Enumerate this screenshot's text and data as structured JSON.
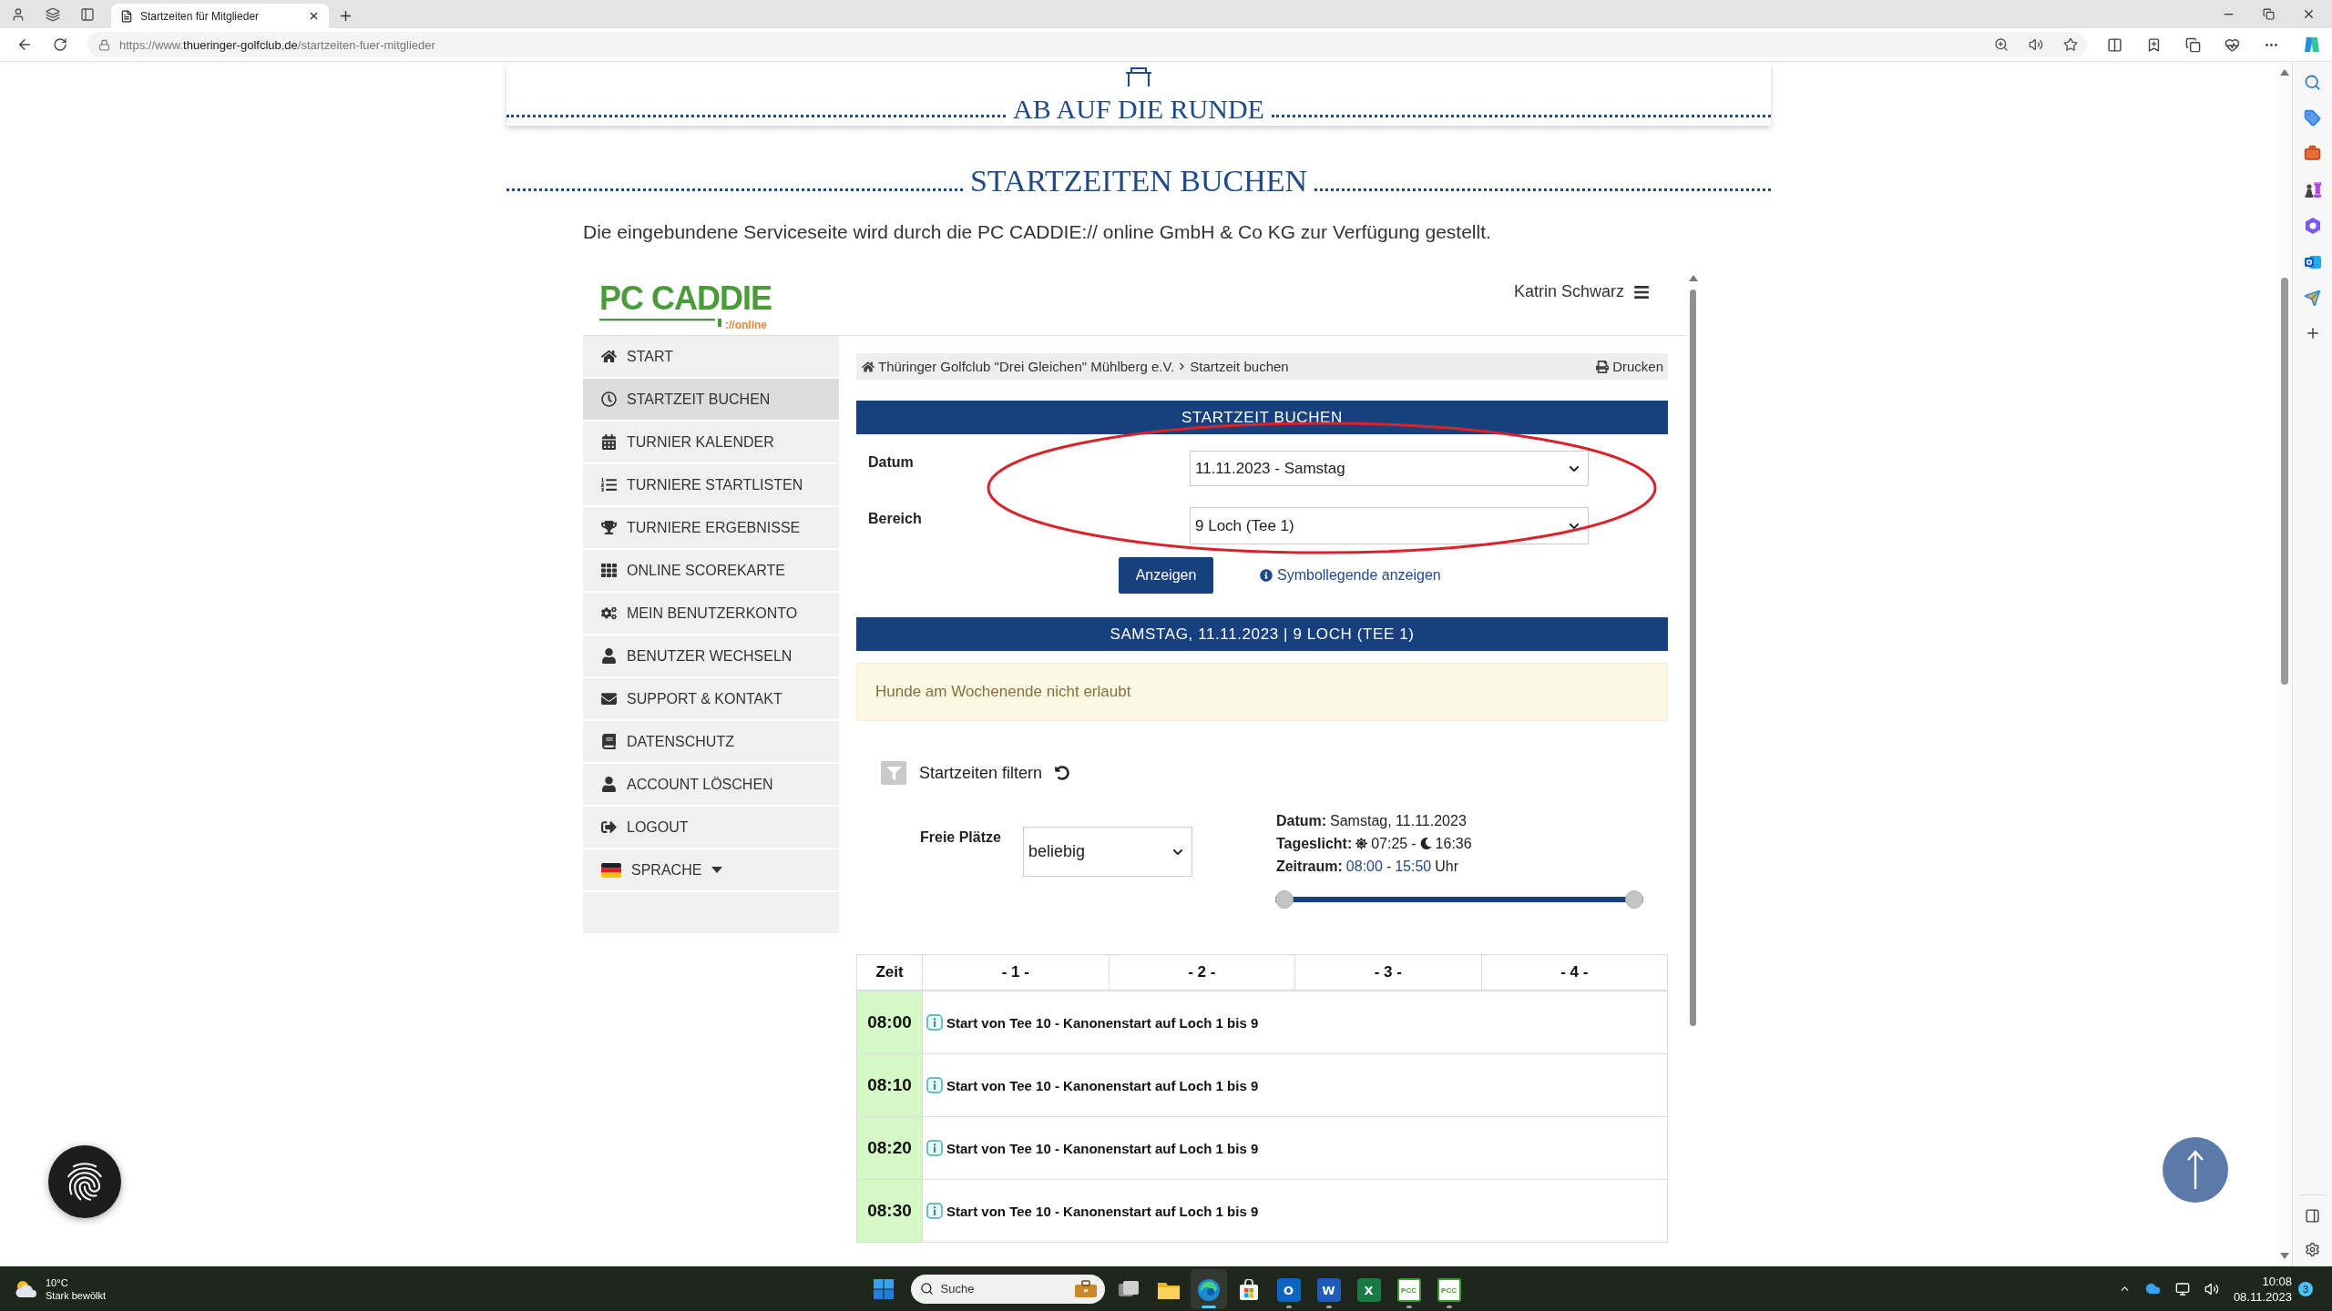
{
  "browser": {
    "tab": {
      "title": "Startzeiten für Mitglieder",
      "selected": true
    },
    "url": {
      "scheme": "https://www.",
      "domain": "thueringer-golfclub.de",
      "path": "/startzeiten-fuer-mitglieder"
    }
  },
  "page": {
    "banner_title": "AB AUF DIE RUNDE",
    "heading": "STARTZEITEN BUCHEN",
    "intro": "Die eingebundene Serviceseite wird durch die PC CADDIE:// online GmbH & Co KG zur Verfügung gestellt."
  },
  "portal": {
    "logo": {
      "name": "PC CADDIE",
      "suffix": "://online"
    },
    "user": "Katrin Schwarz",
    "menu": [
      {
        "label": "START",
        "kind": "link",
        "selected": false
      },
      {
        "label": "STARTZEIT BUCHEN",
        "kind": "link",
        "selected": true
      },
      {
        "label": "TURNIER KALENDER",
        "kind": "link",
        "selected": false
      },
      {
        "label": "TURNIERE STARTLISTEN",
        "kind": "link",
        "selected": false
      },
      {
        "label": "TURNIERE ERGEBNISSE",
        "kind": "link",
        "selected": false
      },
      {
        "label": "ONLINE SCOREKARTE",
        "kind": "link",
        "selected": false
      },
      {
        "label": "MEIN BENUTZERKONTO",
        "kind": "link",
        "selected": false
      },
      {
        "label": "BENUTZER WECHSELN",
        "kind": "link",
        "selected": false
      },
      {
        "label": "SUPPORT & KONTAKT",
        "kind": "link",
        "selected": false
      },
      {
        "label": "DATENSCHUTZ",
        "kind": "link",
        "selected": false
      },
      {
        "label": "ACCOUNT LÖSCHEN",
        "kind": "link",
        "selected": false
      },
      {
        "label": "LOGOUT",
        "kind": "link",
        "selected": false
      },
      {
        "label": "SPRACHE",
        "kind": "dropdown",
        "selected": false
      }
    ],
    "breadcrumb": {
      "items": [
        "Thüringer Golfclub \"Drei Gleichen\" Mühlberg e.V.",
        "Startzeit buchen"
      ],
      "print": "Drucken"
    },
    "booking": {
      "title": "STARTZEIT BUCHEN",
      "fields": [
        {
          "label": "Datum",
          "value": "11.11.2023 - Samstag"
        },
        {
          "label": "Bereich",
          "value": "9 Loch (Tee 1)"
        }
      ],
      "submit": "Anzeigen",
      "legend_link": "Symbollegende anzeigen"
    },
    "annotation": {
      "kind": "ellipse"
    },
    "day_title": "SAMSTAG, 11.11.2023 | 9 LOCH (TEE 1)",
    "notice": "Hunde am Wochenende nicht erlaubt",
    "filter": {
      "title": "Startzeiten filtern",
      "free_places": {
        "label": "Freie Plätze",
        "value": "beliebig"
      },
      "info": {
        "date_label": "Datum:",
        "date": "Samstag, 11.11.2023",
        "daylight_label": "Tageslicht:",
        "sunrise": "07:25",
        "daylight_sep": "-",
        "sunset": "16:36",
        "range_label": "Zeitraum:",
        "range_from": "08:00",
        "range_sep": "-",
        "range_to": "15:50",
        "range_unit": "Uhr"
      },
      "slider": {
        "level": 1
      }
    },
    "table": {
      "columns": [
        "Zeit",
        "- 1 -",
        "- 2 -",
        "- 3 -",
        "- 4 -"
      ],
      "rows": [
        {
          "time": "08:00",
          "note": "Start von Tee 10 - Kanonenstart auf Loch 1 bis 9"
        },
        {
          "time": "08:10",
          "note": "Start von Tee 10 - Kanonenstart auf Loch 1 bis 9"
        },
        {
          "time": "08:20",
          "note": "Start von Tee 10 - Kanonenstart auf Loch 1 bis 9"
        },
        {
          "time": "08:30",
          "note": "Start von Tee 10 - Kanonenstart auf Loch 1 bis 9"
        }
      ]
    }
  },
  "taskbar": {
    "weather": {
      "temp": "10°C",
      "text": "Stark bewölkt"
    },
    "search": {
      "placeholder": "Suche"
    },
    "apps": [
      {
        "kind": "taskview",
        "running": false,
        "selected": false
      },
      {
        "kind": "folder",
        "running": false,
        "selected": false
      },
      {
        "kind": "browser",
        "running": true,
        "selected": true
      },
      {
        "kind": "store",
        "running": false,
        "selected": false
      },
      {
        "kind": "mail",
        "label": "O",
        "running": true,
        "selected": false
      },
      {
        "kind": "doc",
        "label": "W",
        "running": true,
        "selected": false
      },
      {
        "kind": "sheet",
        "label": "X",
        "running": false,
        "selected": false
      },
      {
        "kind": "pcc",
        "label": "PCC",
        "running": true,
        "selected": false
      },
      {
        "kind": "pcc",
        "label": "PCC",
        "running": true,
        "selected": false
      }
    ],
    "clock": {
      "time": "10:08",
      "date": "08.11.2023"
    },
    "notifications": "3"
  }
}
